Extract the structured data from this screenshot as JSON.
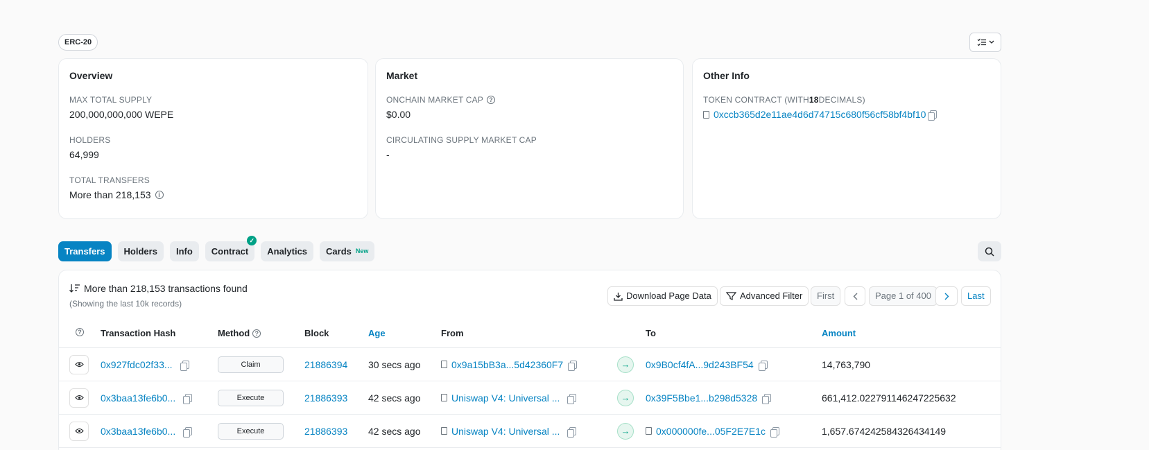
{
  "token_standard": "ERC-20",
  "overview": {
    "title": "Overview",
    "max_supply_label": "MAX TOTAL SUPPLY",
    "max_supply_value": "200,000,000,000 WEPE",
    "holders_label": "HOLDERS",
    "holders_value": "64,999",
    "transfers_label": "TOTAL TRANSFERS",
    "transfers_value": "More than 218,153"
  },
  "market": {
    "title": "Market",
    "onchain_cap_label": "ONCHAIN MARKET CAP",
    "onchain_cap_value": "$0.00",
    "circ_cap_label": "CIRCULATING SUPPLY MARKET CAP",
    "circ_cap_value": "-"
  },
  "other_info": {
    "title": "Other Info",
    "contract_label_prefix": "TOKEN CONTRACT (WITH ",
    "contract_decimals": "18",
    "contract_label_suffix": " DECIMALS)",
    "contract_address": "0xccb365d2e11ae4d6d74715c680f56cf58bf4bf10"
  },
  "tabs": [
    {
      "label": "Transfers"
    },
    {
      "label": "Holders"
    },
    {
      "label": "Info"
    },
    {
      "label": "Contract"
    },
    {
      "label": "Analytics"
    },
    {
      "label": "Cards",
      "badge": "New"
    }
  ],
  "panel": {
    "found_text": "More than 218,153 transactions found",
    "showing_text": "(Showing the last 10k records)",
    "download_label": "Download Page Data",
    "filter_label": "Advanced Filter",
    "first_label": "First",
    "page_label": "Page 1 of 400",
    "last_label": "Last"
  },
  "table": {
    "headers": {
      "hash": "Transaction Hash",
      "method": "Method",
      "block": "Block",
      "age": "Age",
      "from": "From",
      "to": "To",
      "amount": "Amount"
    },
    "rows": [
      {
        "hash": "0x927fdc02f33...",
        "method": "Claim",
        "block": "21886394",
        "age": "30 secs ago",
        "from": "0x9a15bB3a...5d42360F7",
        "to": "0x9B0cf4fA...9d243BF54",
        "amount": "14,763,790"
      },
      {
        "hash": "0x3baa13fe6b0...",
        "method": "Execute",
        "block": "21886393",
        "age": "42 secs ago",
        "from": "Uniswap V4: Universal ...",
        "to": "0x39F5Bbe1...b298d5328",
        "amount": "661,412.022791146247225632"
      },
      {
        "hash": "0x3baa13fe6b0...",
        "method": "Execute",
        "block": "21886393",
        "age": "42 secs ago",
        "from": "Uniswap V4: Universal ...",
        "to": "0x000000fe...05F2E7E1c",
        "amount": "1,657.674242584326434149"
      }
    ]
  },
  "colors": {
    "accent": "#0784c3",
    "success": "#00a186"
  }
}
